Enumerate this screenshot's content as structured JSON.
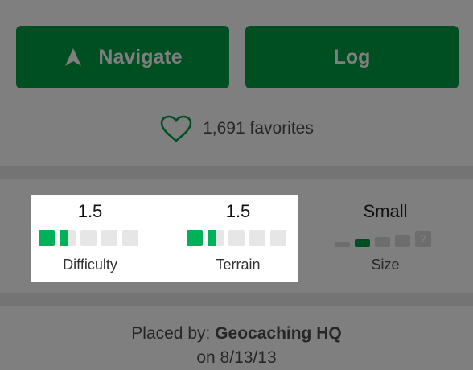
{
  "buttons": {
    "navigate_label": "Navigate",
    "log_label": "Log"
  },
  "favorites": {
    "count_text": "1,691 favorites"
  },
  "stats": {
    "difficulty": {
      "value": "1.5",
      "label": "Difficulty",
      "rating": 1.5,
      "max": 5
    },
    "terrain": {
      "value": "1.5",
      "label": "Terrain",
      "rating": 1.5,
      "max": 5
    },
    "size": {
      "value": "Small",
      "label": "Size",
      "other_symbol": "?"
    }
  },
  "placed": {
    "prefix": "Placed by: ",
    "owner": "Geocaching HQ",
    "date_text": "on 8/13/13"
  },
  "colors": {
    "brand_green": "#00b15a",
    "dark_green": "#004f23",
    "overlay_gray": "#7f7f7f"
  },
  "icons": {
    "navigate": "navigation-arrow-icon",
    "favorite": "heart-outline-icon"
  }
}
